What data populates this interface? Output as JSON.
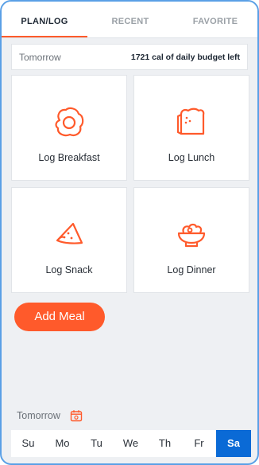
{
  "tabs": [
    {
      "label": "PLAN/LOG",
      "active": true
    },
    {
      "label": "RECENT",
      "active": false
    },
    {
      "label": "FAVORITE",
      "active": false
    }
  ],
  "budget": {
    "day_label": "Tomorrow",
    "remaining_text": "1721 cal of daily budget left"
  },
  "meals": [
    {
      "label": "Log Breakfast",
      "icon": "egg-icon"
    },
    {
      "label": "Log Lunch",
      "icon": "sandwich-icon"
    },
    {
      "label": "Log Snack",
      "icon": "snack-wedge-icon"
    },
    {
      "label": "Log Dinner",
      "icon": "bowl-icon"
    }
  ],
  "add_meal_label": "Add Meal",
  "bottom": {
    "day_label": "Tomorrow",
    "icon": "calendar-icon"
  },
  "week_days": [
    "Su",
    "Mo",
    "Tu",
    "We",
    "Th",
    "Fr",
    "Sa"
  ],
  "selected_day": "Sa",
  "colors": {
    "accent": "#ff5a2b",
    "selected_day_bg": "#0a6ad6",
    "background": "#eef0f3"
  }
}
